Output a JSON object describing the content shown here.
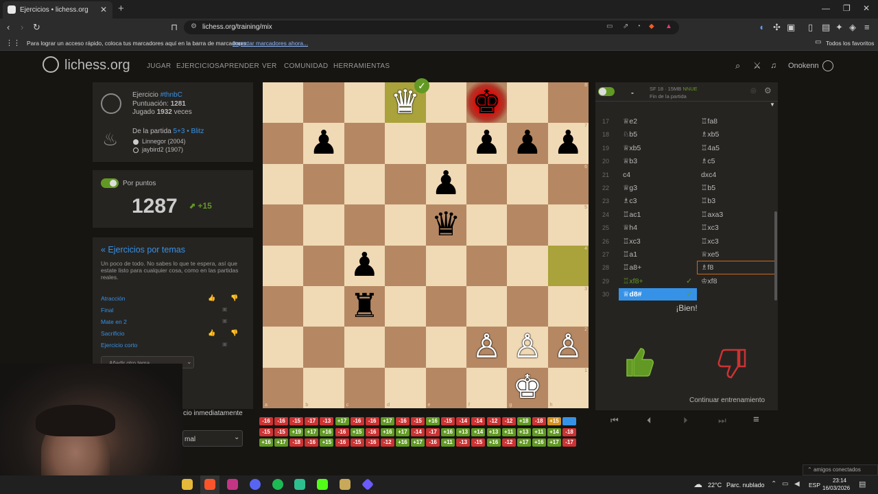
{
  "browser": {
    "tab_title": "Ejercicios • lichess.org",
    "url": "lichess.org/training/mix",
    "bookmarks_hint": "Para lograr un acceso rápido, coloca tus marcadores aquí en la barra de marcadores.",
    "bookmarks_import": "Importar marcadores ahora...",
    "bookmarks_all": "Todos los favoritos"
  },
  "site": {
    "logo": "lichess.org",
    "nav": [
      "JUGAR",
      "EJERCICIOS",
      "APRENDER",
      "VER",
      "COMUNIDAD",
      "HERRAMIENTAS"
    ],
    "username": "Onokenn"
  },
  "puzzle": {
    "label": "Ejercicio",
    "id": "#thnbC",
    "rating_label": "Puntuación:",
    "rating": "1281",
    "played_label": "Jugado",
    "played": "1932",
    "played_suffix": "veces",
    "game_label": "De la partida",
    "game_link": "5+3 • Blitz",
    "white_player": "Linnegor (2004)",
    "black_player": "jaybird2 (1907)"
  },
  "score": {
    "toggle_label": "Por puntos",
    "rating": "1287",
    "delta": "+15"
  },
  "themes": {
    "back_link": "« Ejercicios por temas",
    "desc": "Un poco de todo. No sabes lo que te espera, así que estate listo para cualquier cosa, como en las partidas reales.",
    "items": [
      "Atracción",
      "Final",
      "Mate en 2",
      "Sacrificio",
      "Ejercicio corto"
    ],
    "add_theme": "Añadir otro tema",
    "jump_text": "cio inmediatamente",
    "select_text": "mal"
  },
  "engine": {
    "line1": "SF 18 · 15MB",
    "nnue": "NNUE",
    "line2": "Fin de la partida",
    "eval": "-"
  },
  "moves": [
    {
      "n": "17",
      "w": "♕e2",
      "b": "♖fa8"
    },
    {
      "n": "18",
      "w": "♘b5",
      "b": "♗xb5"
    },
    {
      "n": "19",
      "w": "♕xb5",
      "b": "♖4a5"
    },
    {
      "n": "20",
      "w": "♕b3",
      "b": "♗c5"
    },
    {
      "n": "21",
      "w": "c4",
      "b": "dxc4"
    },
    {
      "n": "22",
      "w": "♕g3",
      "b": "♖b5"
    },
    {
      "n": "23",
      "w": "♗c3",
      "b": "♖b3"
    },
    {
      "n": "24",
      "w": "♖ac1",
      "b": "♖axa3"
    },
    {
      "n": "25",
      "w": "♕h4",
      "b": "♖xc3"
    },
    {
      "n": "26",
      "w": "♖xc3",
      "b": "♖xc3"
    },
    {
      "n": "27",
      "w": "♖a1",
      "b": "♕xe5"
    },
    {
      "n": "28",
      "w": "♖a8+",
      "b": "♗f8"
    },
    {
      "n": "29",
      "w": "♖xf8+",
      "b": "♔xf8"
    },
    {
      "n": "30",
      "w": "♕d8#",
      "b": ""
    }
  ],
  "feedback": {
    "good": "¡Bien!",
    "continue": "Continuar entrenamiento",
    "check": "✓"
  },
  "results": [
    [
      "-16",
      "-16",
      "-15",
      "-17",
      "-13",
      "+17",
      "-16",
      "-16",
      "+17",
      "-16",
      "-15",
      "+16",
      "-15",
      "-14",
      "-14",
      "-12",
      "-12",
      "+18",
      "-18",
      "+15",
      ""
    ],
    [
      "-15",
      "-15",
      "+19",
      "+17",
      "+16",
      "-16",
      "+15",
      "-16",
      "+16",
      "+17",
      "-14",
      "-17",
      "+16",
      "+13",
      "+14",
      "+13",
      "+11",
      "+13",
      "+11",
      "+14",
      "-18"
    ],
    [
      "+16",
      "+17",
      "-18",
      "-16",
      "+15",
      "-16",
      "-15",
      "-16",
      "-12",
      "+16",
      "+17",
      "-16",
      "+11",
      "-13",
      "-15",
      "+16",
      "-12",
      "+17",
      "+16",
      "+17",
      "-17"
    ]
  ],
  "board_files": [
    "a",
    "b",
    "c",
    "d",
    "e",
    "f",
    "g",
    "h"
  ],
  "board_ranks": [
    "8",
    "7",
    "6",
    "5",
    "4",
    "3",
    "2",
    "1"
  ],
  "taskbar": {
    "weather_temp": "22°C",
    "weather_text": "Parc. nublado",
    "lang": "ESP",
    "time": "23:14",
    "date": "16/03/2026",
    "friends": "amigos conectados"
  },
  "colors": {
    "bg": "#161512",
    "panel": "#262421",
    "light_sq": "#f0d9b5",
    "dark_sq": "#b58863",
    "good": "#629924",
    "bad": "#cc3333",
    "link": "#3692e7"
  }
}
